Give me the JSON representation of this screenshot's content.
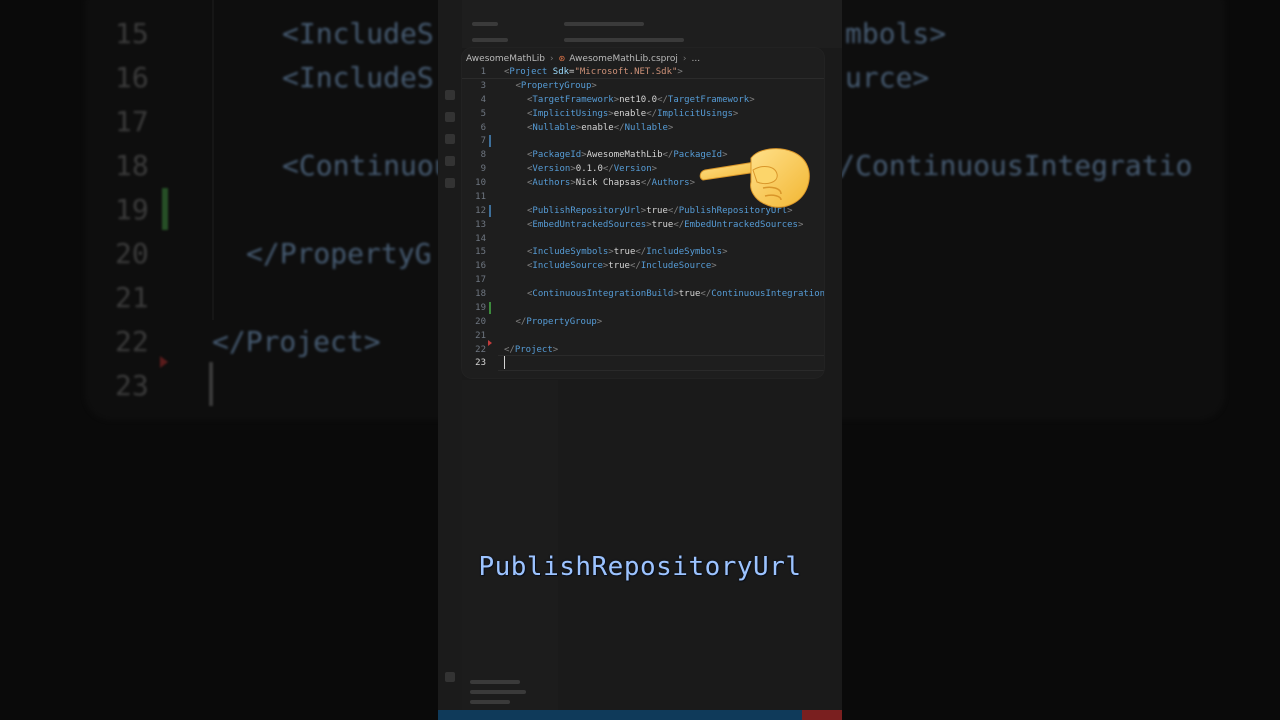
{
  "breadcrumb": {
    "folder": "AwesomeMathLib",
    "file": "AwesomeMathLib.csproj",
    "ellipsis": "..."
  },
  "editor": {
    "lines": [
      {
        "n": "1",
        "indent": 0,
        "kind": "open-attr",
        "tag": "Project",
        "attr": "Sdk",
        "value": "\"Microsoft.NET.Sdk\""
      },
      {
        "n": "3",
        "indent": 1,
        "kind": "open",
        "tag": "PropertyGroup"
      },
      {
        "n": "4",
        "indent": 2,
        "kind": "elem",
        "tag": "TargetFramework",
        "text": "net10.0"
      },
      {
        "n": "5",
        "indent": 2,
        "kind": "elem",
        "tag": "ImplicitUsings",
        "text": "enable"
      },
      {
        "n": "6",
        "indent": 2,
        "kind": "elem",
        "tag": "Nullable",
        "text": "enable"
      },
      {
        "n": "7",
        "indent": 2,
        "kind": "blank"
      },
      {
        "n": "8",
        "indent": 2,
        "kind": "elem",
        "tag": "PackageId",
        "text": "AwesomeMathLib"
      },
      {
        "n": "9",
        "indent": 2,
        "kind": "elem",
        "tag": "Version",
        "text": "0.1.0"
      },
      {
        "n": "10",
        "indent": 2,
        "kind": "elem",
        "tag": "Authors",
        "text": "Nick Chapsas"
      },
      {
        "n": "11",
        "indent": 2,
        "kind": "blank"
      },
      {
        "n": "12",
        "indent": 2,
        "kind": "elem",
        "tag": "PublishRepositoryUrl",
        "text": "true"
      },
      {
        "n": "13",
        "indent": 2,
        "kind": "elem",
        "tag": "EmbedUntrackedSources",
        "text": "true"
      },
      {
        "n": "14",
        "indent": 2,
        "kind": "blank"
      },
      {
        "n": "15",
        "indent": 2,
        "kind": "elem",
        "tag": "IncludeSymbols",
        "text": "true"
      },
      {
        "n": "16",
        "indent": 2,
        "kind": "elem",
        "tag": "IncludeSource",
        "text": "true"
      },
      {
        "n": "17",
        "indent": 2,
        "kind": "blank"
      },
      {
        "n": "18",
        "indent": 2,
        "kind": "elem",
        "tag": "ContinuousIntegrationBuild",
        "text": "true"
      },
      {
        "n": "19",
        "indent": 2,
        "kind": "blank"
      },
      {
        "n": "20",
        "indent": 1,
        "kind": "close",
        "tag": "PropertyGroup"
      },
      {
        "n": "21",
        "indent": 0,
        "kind": "blank"
      },
      {
        "n": "22",
        "indent": 0,
        "kind": "close",
        "tag": "Project"
      },
      {
        "n": "23",
        "indent": 0,
        "kind": "blank",
        "current": true
      }
    ],
    "gutter_marks": {
      "blue": [
        "7",
        "12"
      ],
      "green": [
        "19"
      ],
      "red": [
        "22"
      ]
    }
  },
  "background": {
    "lines": [
      {
        "n": "15",
        "code": "<IncludeS",
        "tail": "mbols>"
      },
      {
        "n": "16",
        "code": "<IncludeS",
        "tail": "urce>"
      },
      {
        "n": "17",
        "code": "",
        "tail": ""
      },
      {
        "n": "18",
        "code": "<ContinuousIntegrationBuild>true</ContinuousIntegratio",
        "tail": ""
      },
      {
        "n": "19",
        "code": "",
        "tail": ""
      },
      {
        "n": "20",
        "code": "</PropertyG",
        "tail": ""
      },
      {
        "n": "21",
        "code": "",
        "tail": ""
      },
      {
        "n": "22",
        "code": "</Project>",
        "tail": ""
      },
      {
        "n": "23",
        "code": "",
        "tail": ""
      }
    ]
  },
  "caption": "PublishRepositoryUrl",
  "colors": {
    "tag": "#569cd6",
    "bracket": "#808080",
    "attribute": "#9cdcfe",
    "string": "#ce9178",
    "caption": "#9cc3ff"
  },
  "icons": {
    "pointer": "backhand-index-pointing-left-emoji",
    "breadcrumb_file": "rss-icon"
  }
}
